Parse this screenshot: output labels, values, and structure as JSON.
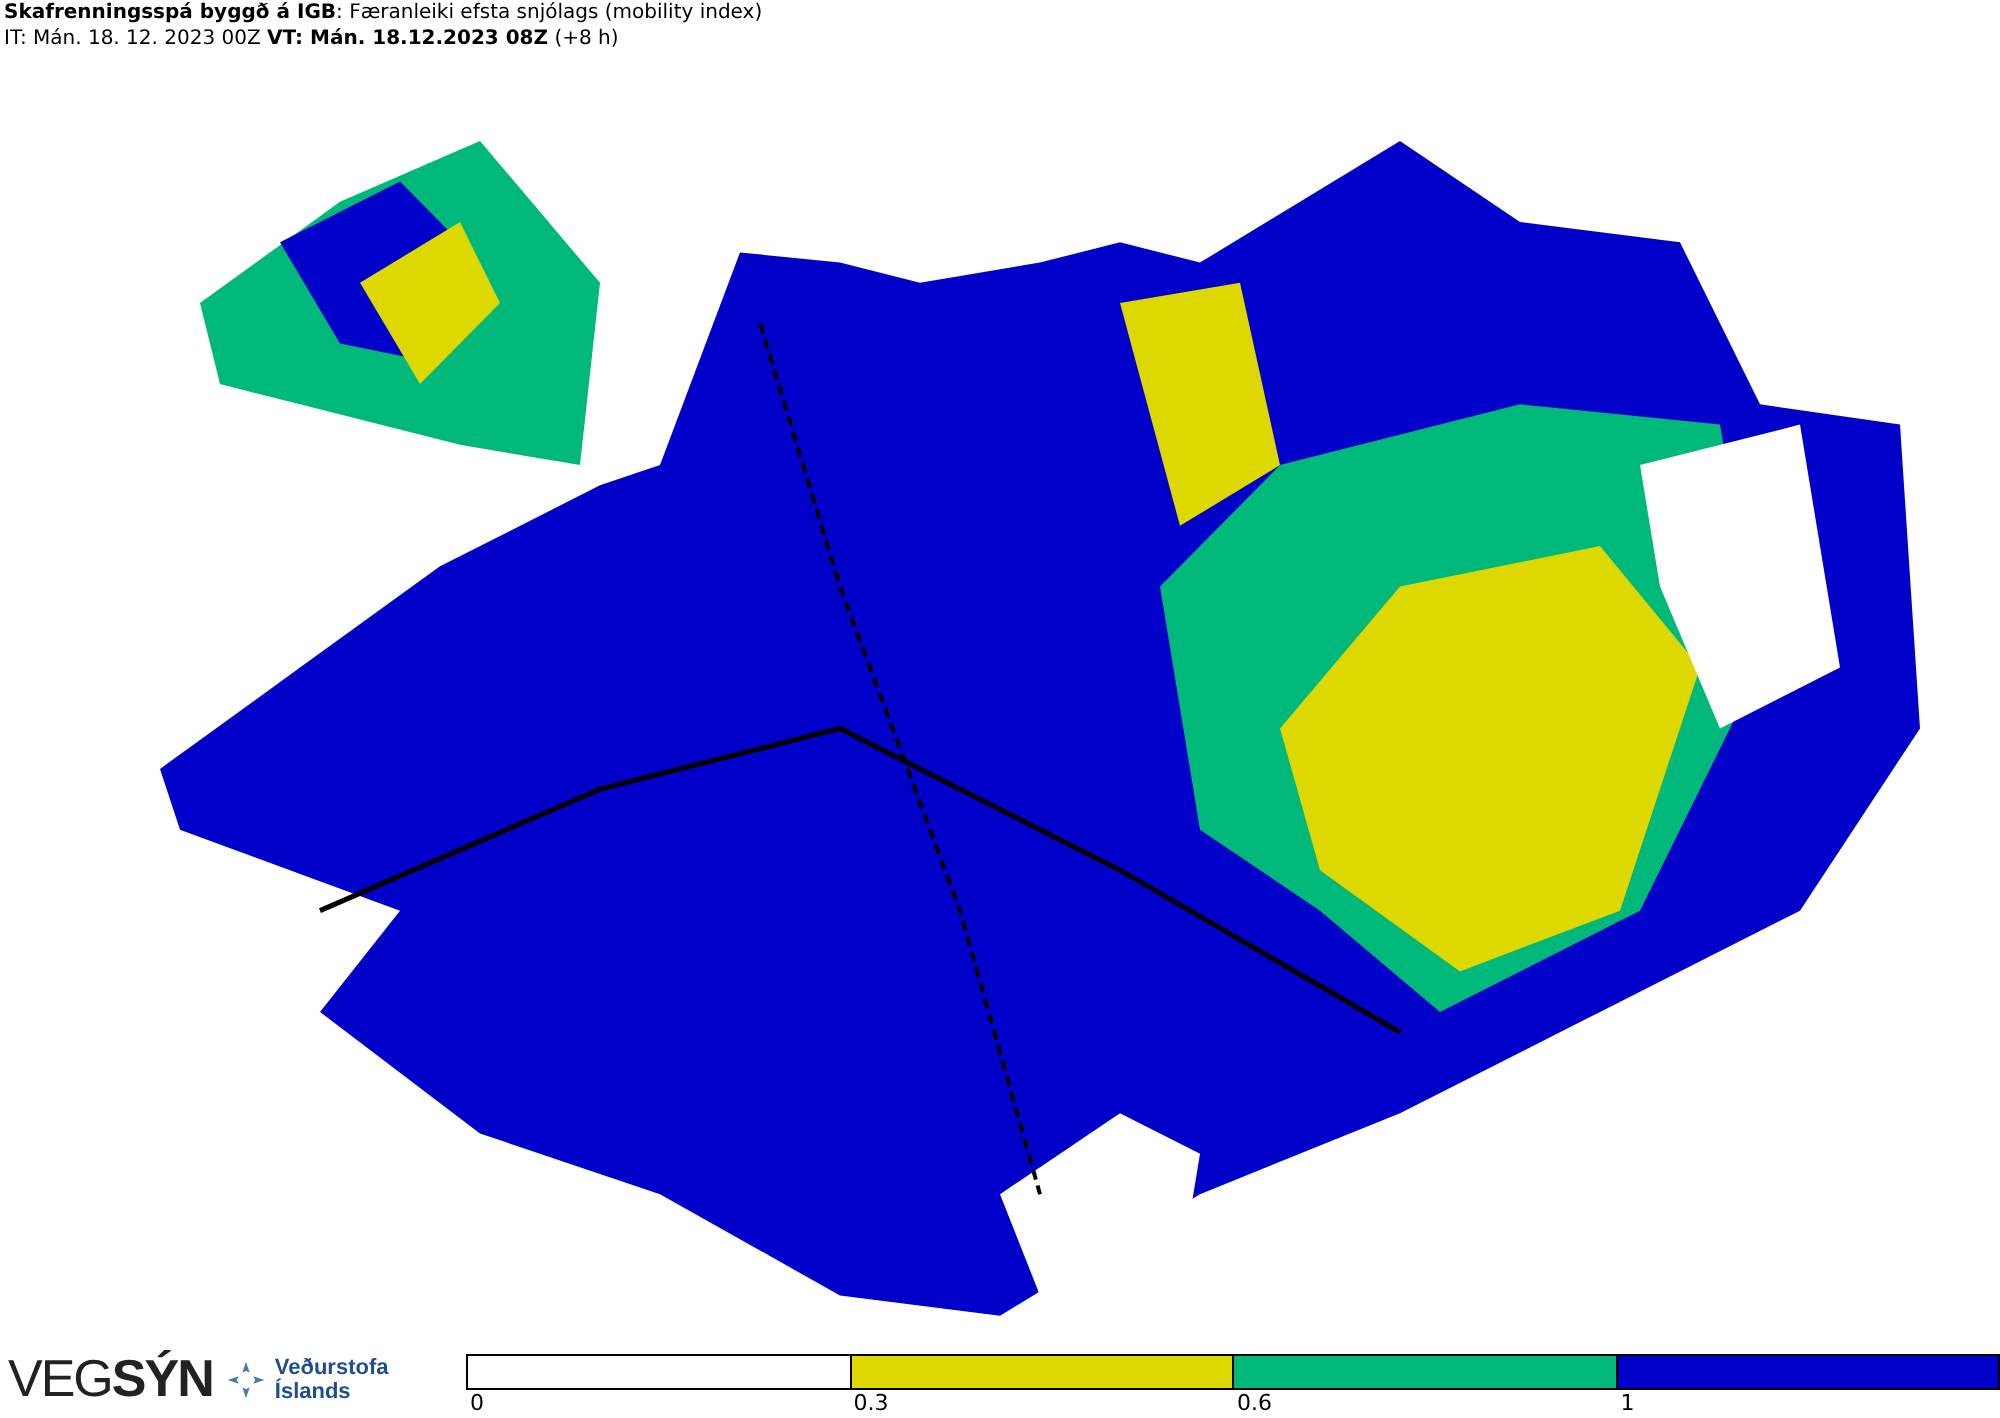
{
  "header": {
    "title": "**Skafrenningsspá byggð á IGB**: Færanleiki efsta snjólags (mobility index)",
    "subtitle": "IT: Mán. 18. 12. 2023 00Z **VT: Mán. 18.12.2023 08Z** (+8 h)"
  },
  "logos": {
    "vegsyn": "VEG**SÝN**",
    "vedurstofa": [
      "Veðurstofa",
      "Íslands"
    ]
  },
  "legend": [
    {
      "label": "0",
      "color": "#ffffff"
    },
    {
      "label": "0.3",
      "color": "#dcd800"
    },
    {
      "label": "0.6",
      "color": "#00b87a"
    },
    {
      "label": "1",
      "color": "#0000c8"
    }
  ]
}
